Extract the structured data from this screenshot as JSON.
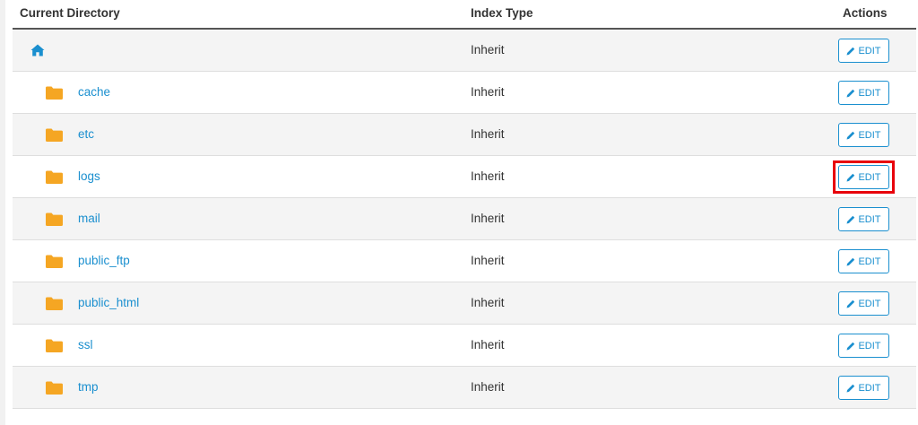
{
  "columns": {
    "directory": "Current Directory",
    "index_type": "Index Type",
    "actions": "Actions"
  },
  "edit_label": "EDIT",
  "highlighted_row": "logs",
  "colors": {
    "link": "#1a8fcf",
    "folder": "#f5a623",
    "highlight": "#e8000b"
  },
  "rows": [
    {
      "name": "",
      "icon": "home-icon",
      "index_type": "Inherit"
    },
    {
      "name": "cache",
      "icon": "folder-icon",
      "index_type": "Inherit"
    },
    {
      "name": "etc",
      "icon": "folder-icon",
      "index_type": "Inherit"
    },
    {
      "name": "logs",
      "icon": "folder-icon",
      "index_type": "Inherit"
    },
    {
      "name": "mail",
      "icon": "folder-icon",
      "index_type": "Inherit"
    },
    {
      "name": "public_ftp",
      "icon": "folder-icon",
      "index_type": "Inherit"
    },
    {
      "name": "public_html",
      "icon": "folder-icon",
      "index_type": "Inherit"
    },
    {
      "name": "ssl",
      "icon": "folder-icon",
      "index_type": "Inherit"
    },
    {
      "name": "tmp",
      "icon": "folder-icon",
      "index_type": "Inherit"
    }
  ]
}
